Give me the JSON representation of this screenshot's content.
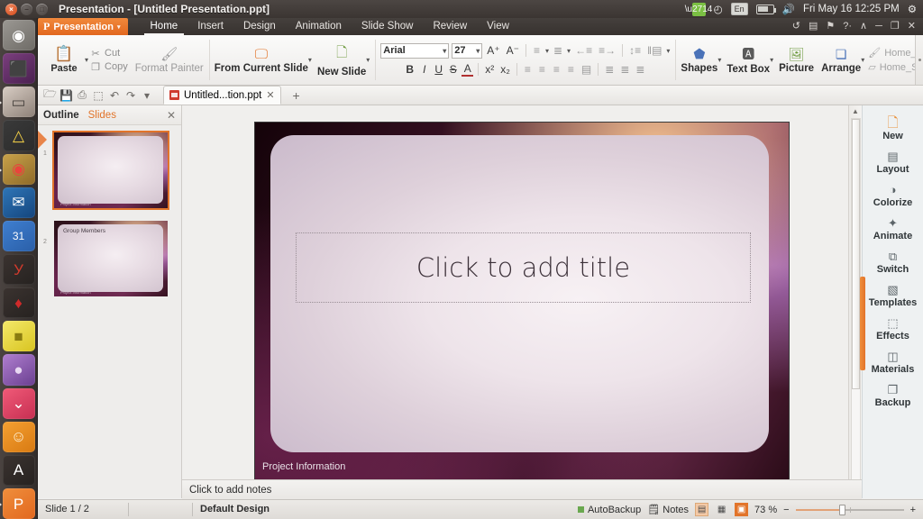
{
  "top_panel": {
    "window_title": "Presentation - [Untitled Presentation.ppt]",
    "close_glyph": "×",
    "minimize_glyph": "−",
    "maximize_glyph": "□",
    "tray": {
      "sync_icon": "sync-icon",
      "wifi_glyph": "◴",
      "keyboard_layout": "En",
      "battery_icon": "battery-icon",
      "volume_glyph": "🔊",
      "clock": "Fri May 16 12:25 PM",
      "gear_glyph": "⚙"
    }
  },
  "launcher": {
    "items": [
      {
        "name": "ubuntu-dash-icon",
        "glyph": "◉",
        "bg": "linear-gradient(145deg,#9b9893,#6e6b66)",
        "color": "#fff"
      },
      {
        "name": "files-window-icon",
        "glyph": "⬛",
        "bg": "linear-gradient(145deg,#7b3f7e,#4a2050)",
        "color": "#e6d6ea"
      },
      {
        "name": "file-manager-icon",
        "glyph": "▭",
        "bg": "linear-gradient(145deg,#d8cdc4,#8d8077)",
        "color": "#4a4440"
      },
      {
        "name": "google-drive-icon",
        "glyph": "△",
        "bg": "linear-gradient(145deg,#3a3a3a,#2b2b2b)",
        "color": "#f8d448"
      },
      {
        "name": "google-chrome-icon",
        "glyph": "◉",
        "bg": "linear-gradient(145deg,#c9a24a,#8e6a28)",
        "color": "#e8453c"
      },
      {
        "name": "outlook-icon",
        "glyph": "✉",
        "bg": "linear-gradient(145deg,#2f76b8,#14457d)",
        "color": "#fff"
      },
      {
        "name": "calendar-icon",
        "glyph": "31",
        "bg": "linear-gradient(145deg,#3f7fd0,#2a5fa8)",
        "color": "#fff"
      },
      {
        "name": "yandex-icon",
        "glyph": "У",
        "bg": "linear-gradient(145deg,#3b3330,#262220)",
        "color": "#d33a2c"
      },
      {
        "name": "adobe-icon",
        "glyph": "♦",
        "bg": "linear-gradient(145deg,#3b3330,#262220)",
        "color": "#cf2a2a"
      },
      {
        "name": "notes-icon",
        "glyph": "■",
        "bg": "linear-gradient(145deg,#f4e96a,#d8c420)",
        "color": "#8a7c10"
      },
      {
        "name": "media-player-icon",
        "glyph": "●",
        "bg": "linear-gradient(145deg,#b07fd0,#6a3f90)",
        "color": "#e8d8f2"
      },
      {
        "name": "download-manager-icon",
        "glyph": "⌄",
        "bg": "linear-gradient(145deg,#f05a78,#c72f52)",
        "color": "#fff"
      },
      {
        "name": "smile-app-icon",
        "glyph": "☺",
        "bg": "linear-gradient(145deg,#f5a032,#d87a12)",
        "color": "#fff6e0"
      },
      {
        "name": "anydesk-icon",
        "glyph": "A",
        "bg": "linear-gradient(145deg,#3b3330,#262220)",
        "color": "#fff"
      },
      {
        "name": "presentation-app-icon",
        "glyph": "P",
        "bg": "linear-gradient(145deg,#ef8e3c,#e2681f)",
        "color": "#fff"
      }
    ]
  },
  "ribbon": {
    "app_tab": {
      "label": "Presentation",
      "glyph": "P",
      "caret": "▾"
    },
    "tabs": [
      {
        "label": "Home",
        "active": true
      },
      {
        "label": "Insert",
        "active": false
      },
      {
        "label": "Design",
        "active": false
      },
      {
        "label": "Animation",
        "active": false
      },
      {
        "label": "Slide Show",
        "active": false
      },
      {
        "label": "Review",
        "active": false
      },
      {
        "label": "View",
        "active": false
      }
    ],
    "right_icons": [
      {
        "name": "undo-history-icon",
        "glyph": "↺"
      },
      {
        "name": "save-status-icon",
        "glyph": "▤"
      },
      {
        "name": "alert-icon",
        "glyph": "⚑"
      },
      {
        "name": "help-icon",
        "glyph": "?·"
      },
      {
        "name": "collapse-ribbon-icon",
        "glyph": "∧"
      },
      {
        "name": "minimize-icon",
        "glyph": "─"
      },
      {
        "name": "restore-icon",
        "glyph": "❐"
      },
      {
        "name": "close-icon",
        "glyph": "✕"
      }
    ],
    "clipboard": {
      "paste_label": "Paste",
      "paste_caret": "▾",
      "cut_label": "Cut",
      "copy_label": "Copy",
      "format_painter_label": "Format Painter"
    },
    "slides_group": {
      "from_current_slide_label": "From Current Slide",
      "from_current_slide_caret": "▾",
      "new_slide_label": "New Slide",
      "new_slide_caret": "▾"
    },
    "font": {
      "font_name": "Arial",
      "font_size": "27",
      "grow_font": "A⁺",
      "shrink_font": "A⁻",
      "bold": "B",
      "italic": "I",
      "underline": "U",
      "strikethrough": "S",
      "text_color": "A",
      "superscript": "x²",
      "subscript": "x₂",
      "bullets": "≡",
      "numbering": "≣",
      "decrease_indent": "←≡",
      "increase_indent": "≡→",
      "line_spacing": "↕≡",
      "columns": "‖▤",
      "align_left": "≡",
      "align_center": "≡",
      "align_right": "≡",
      "justify": "≡",
      "distribute": "▤",
      "paragraph_a": "≣",
      "paragraph_b": "≣",
      "paragraph_c": "≣"
    },
    "drawing": {
      "shapes_label": "Shapes",
      "shapes_caret": "▾",
      "textbox_label": "Text Box",
      "textbox_caret": "▾",
      "picture_label": "Picture",
      "arrange_label": "Arrange",
      "arrange_caret": "▾",
      "shape_fill_label": "Home_Shape Fill",
      "shape_line_label": "Home_Shape Line"
    }
  },
  "doc_toolbar": {
    "icons": [
      {
        "name": "open-folder-icon",
        "glyph": "🗁"
      },
      {
        "name": "save-icon",
        "glyph": "💾"
      },
      {
        "name": "print-icon",
        "glyph": "⎙"
      },
      {
        "name": "new-document-icon",
        "glyph": "⬚"
      },
      {
        "name": "undo-icon",
        "glyph": "↶"
      },
      {
        "name": "redo-icon",
        "glyph": "↷"
      },
      {
        "name": "customize-toolbar-icon",
        "glyph": "▾"
      }
    ],
    "tab_label": "Untitled...tion.ppt",
    "tab_close": "✕",
    "new_tab": "+"
  },
  "outline_panel": {
    "tab_outline": "Outline",
    "tab_slides": "Slides",
    "close_glyph": "✕",
    "slides": [
      {
        "number": "1",
        "title": "",
        "footer": "Project Information",
        "selected": true
      },
      {
        "number": "2",
        "title": "Group Members",
        "footer": "Project Information",
        "selected": false
      }
    ]
  },
  "slide": {
    "title_placeholder": "Click to add title",
    "footer_text": "Project Information"
  },
  "side_panel": {
    "items": [
      {
        "label": "New",
        "icon": "new-slide-icon",
        "glyph": "🗋"
      },
      {
        "label": "Layout",
        "icon": "layout-icon",
        "glyph": "▤"
      },
      {
        "label": "Colorize",
        "icon": "colorize-icon",
        "glyph": "◑"
      },
      {
        "label": "Animate",
        "icon": "animate-icon",
        "glyph": "✦"
      },
      {
        "label": "Switch",
        "icon": "switch-icon",
        "glyph": "⧉"
      },
      {
        "label": "Templates",
        "icon": "templates-icon",
        "glyph": "▧"
      },
      {
        "label": "Effects",
        "icon": "effects-icon",
        "glyph": "⬚"
      },
      {
        "label": "Materials",
        "icon": "materials-icon",
        "glyph": "◫"
      },
      {
        "label": "Backup",
        "icon": "backup-icon",
        "glyph": "❐"
      }
    ]
  },
  "notes": {
    "placeholder": "Click to add notes"
  },
  "status_bar": {
    "slide_counter": "Slide 1 / 2",
    "design_name": "Default Design",
    "autobackup_label": "AutoBackup",
    "notes_label": "Notes",
    "notes_icon": "notes-icon",
    "view_normal_icon": "normal-view-icon",
    "view_sorter_icon": "slide-sorter-icon",
    "view_show_icon": "slideshow-view-icon",
    "zoom_level": "73 %",
    "zoom_out": "−",
    "zoom_in": "+"
  }
}
